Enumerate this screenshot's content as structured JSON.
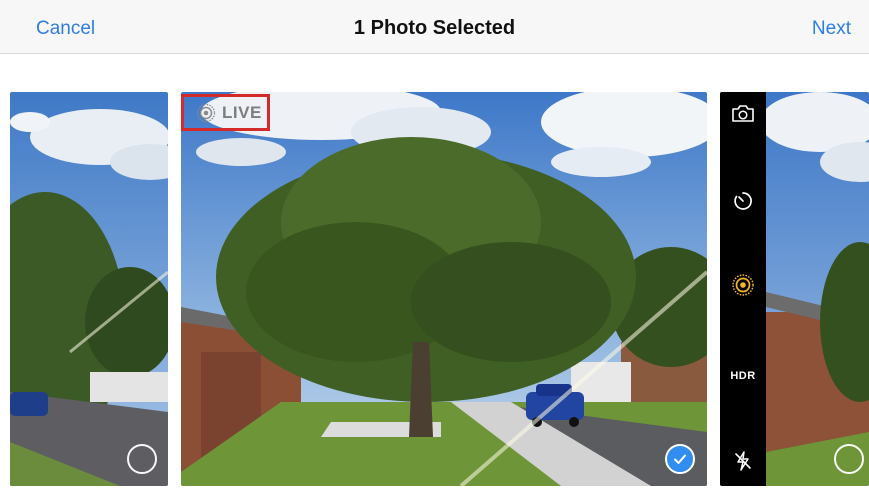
{
  "navbar": {
    "cancel_label": "Cancel",
    "title": "1 Photo Selected",
    "next_label": "Next"
  },
  "main_photo": {
    "live_badge": "LIVE",
    "selected": true
  },
  "left_photo": {
    "selected": false
  },
  "right_photo": {
    "selected": false,
    "camera_controls": {
      "items": [
        "camera-switch-icon",
        "timer-icon",
        "live-photo-icon",
        "HDR",
        "flash-off-icon"
      ],
      "hdr_label": "HDR"
    }
  },
  "colors": {
    "accent": "#2f7de1",
    "highlight_box": "#d52a2a",
    "live_active": "#f3b728",
    "check_fill": "#2f8ef0"
  }
}
